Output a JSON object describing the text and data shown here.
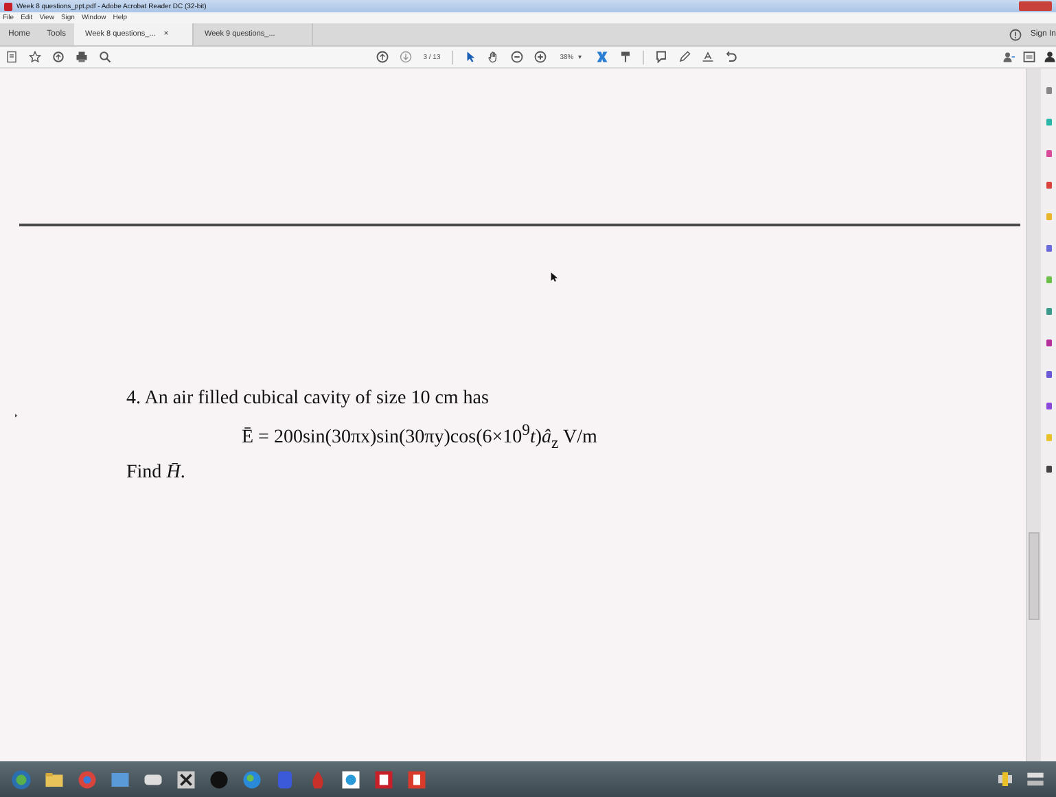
{
  "window": {
    "title": "Week 8 questions_ppt.pdf - Adobe Acrobat Reader DC (32-bit)"
  },
  "menu": [
    "File",
    "Edit",
    "View",
    "Sign",
    "Window",
    "Help"
  ],
  "nav": [
    "Home",
    "Tools"
  ],
  "tabs": [
    {
      "label": "Week 8 questions_...",
      "close": "×",
      "selected": true
    },
    {
      "label": "Week 9 questions_...",
      "selected": false
    }
  ],
  "account": {
    "sign_in": "Sign In"
  },
  "toolbar": {
    "page": "3 / 13",
    "zoom": "38%",
    "zoom_caret": "▾"
  },
  "document": {
    "lines": [
      {
        "kind": "text",
        "text": "4. An air filled cubical cavity of size 10 cm has"
      },
      {
        "kind": "formula",
        "text": "Ē = 200sin(30πx)sin(30πy)cos(6×10$^{9}$*t*)*â*$_{z}$ V/m"
      },
      {
        "kind": "text",
        "text": "Find *H̄*."
      }
    ]
  }
}
